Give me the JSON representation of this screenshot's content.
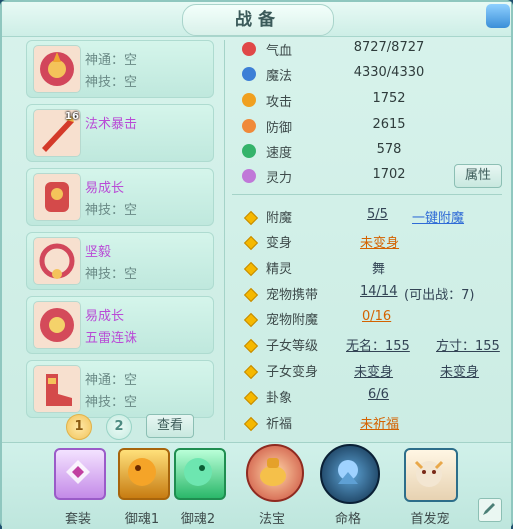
{
  "window": {
    "title": "战备"
  },
  "equipment": [
    {
      "line1": "神通：空",
      "line2": "神技：空",
      "line1_magic": false,
      "line2_magic": false,
      "badge": ""
    },
    {
      "line1": "法术暴击",
      "line2": "",
      "line1_magic": true,
      "line2_magic": false,
      "badge": "16"
    },
    {
      "line1": "易成长",
      "line2": "神技：空",
      "line1_magic": true,
      "line2_magic": false,
      "badge": ""
    },
    {
      "line1": "坚毅",
      "line2": "神技：空",
      "line1_magic": true,
      "line2_magic": false,
      "badge": ""
    },
    {
      "line1": "易成长",
      "line2": "五雷连诛",
      "line1_magic": true,
      "line2_magic": true,
      "badge": ""
    },
    {
      "line1": "神通：空",
      "line2": "神技：空",
      "line1_magic": false,
      "line2_magic": false,
      "badge": ""
    }
  ],
  "pagination": {
    "page1": "1",
    "page2": "2",
    "view_label": "查看"
  },
  "stats": [
    {
      "label": "气血",
      "value": "8727/8727",
      "icon": "heart-icon",
      "color": "#e04848"
    },
    {
      "label": "魔法",
      "value": "4330/4330",
      "icon": "mana-icon",
      "color": "#3d7fd6"
    },
    {
      "label": "攻击",
      "value": "1752",
      "icon": "attack-icon",
      "color": "#f0a020"
    },
    {
      "label": "防御",
      "value": "2615",
      "icon": "shield-icon",
      "color": "#f08a3a"
    },
    {
      "label": "速度",
      "value": "578",
      "icon": "speed-icon",
      "color": "#34b36a"
    },
    {
      "label": "灵力",
      "value": "1702",
      "icon": "spirit-icon",
      "color": "#c078d8"
    }
  ],
  "attr_button": "属性",
  "attributes": {
    "fumo": {
      "label": "附魔",
      "value": "5/5",
      "action": "一键附魔"
    },
    "bianshen": {
      "label": "变身",
      "value": "未变身"
    },
    "jingling": {
      "label": "精灵",
      "value": "舞"
    },
    "chongwu": {
      "label": "宠物携带",
      "value": "14/14",
      "extra": "(可出战：7)"
    },
    "chongwu_fumo": {
      "label": "宠物附魔",
      "value": "0/16"
    },
    "zinv_dengji": {
      "label": "子女等级",
      "v1": "无名：155",
      "v2": "方寸：155"
    },
    "zinv_bianshen": {
      "label": "子女变身",
      "v1": "未变身",
      "v2": "未变身"
    },
    "guaxiang": {
      "label": "卦象",
      "value": "6/6"
    },
    "qifu": {
      "label": "祈福",
      "value": "未祈福"
    }
  },
  "bottom_tools": [
    {
      "label": "套装",
      "icon": "suit-icon"
    },
    {
      "label": "御魂1",
      "icon": "dragon-soul-icon"
    },
    {
      "label": "御魂2",
      "icon": "jade-dragon-icon"
    },
    {
      "label": "法宝",
      "icon": "treasure-icon"
    },
    {
      "label": "命格",
      "icon": "fate-icon"
    },
    {
      "label": "首发宠",
      "icon": "pet-icon"
    }
  ]
}
